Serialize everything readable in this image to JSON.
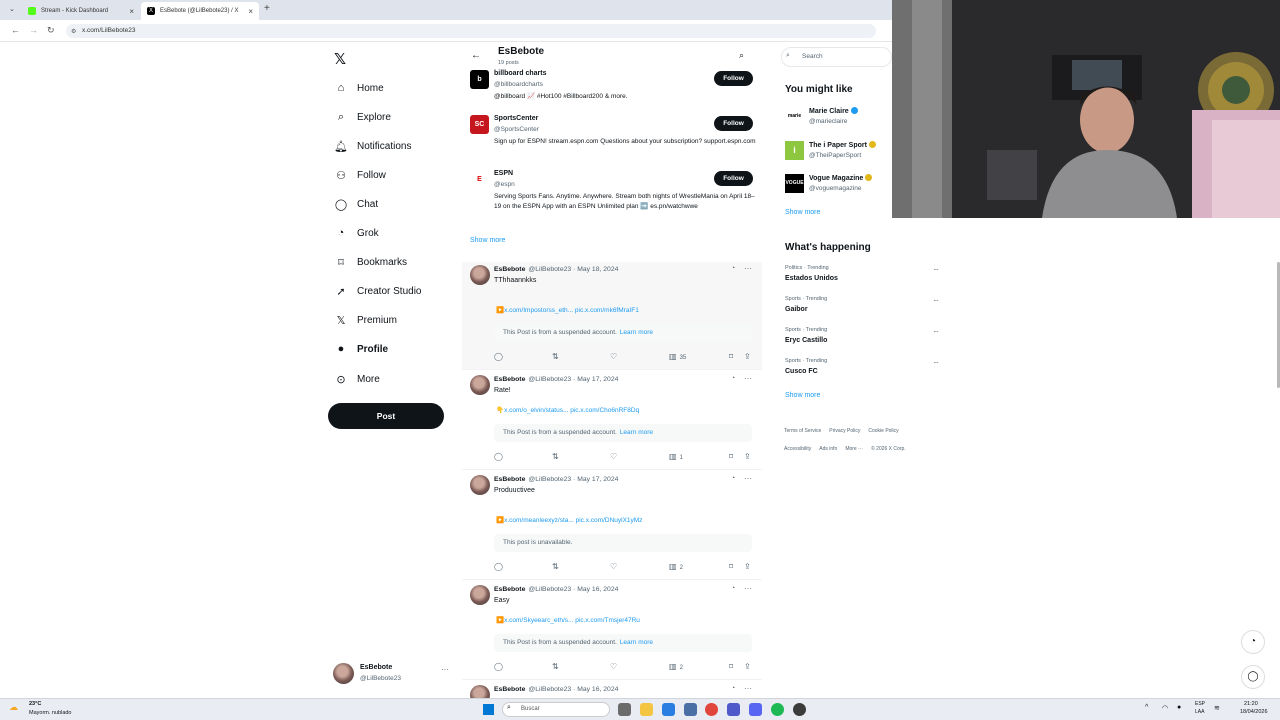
{
  "browser": {
    "tabs": [
      {
        "title": "Stream - Kick Dashboard",
        "color": "#53fc18"
      },
      {
        "title": "EsBebote (@LilBebote23) / X",
        "color": "#000000"
      }
    ],
    "url": "x.com/LilBebote23"
  },
  "sidebar": {
    "logo_icon": "x-logo-icon",
    "items": [
      {
        "label": "Home",
        "icon": "home-icon",
        "glyph": "⌂"
      },
      {
        "label": "Explore",
        "icon": "search-icon",
        "glyph": "⌕"
      },
      {
        "label": "Notifications",
        "icon": "bell-icon",
        "glyph": "🔔︎"
      },
      {
        "label": "Follow",
        "icon": "follow-icon",
        "glyph": "⚇"
      },
      {
        "label": "Chat",
        "icon": "chat-icon",
        "glyph": "◯"
      },
      {
        "label": "Grok",
        "icon": "grok-icon",
        "glyph": "◔"
      },
      {
        "label": "Bookmarks",
        "icon": "bookmark-icon",
        "glyph": "⌑"
      },
      {
        "label": "Creator Studio",
        "icon": "rocket-icon",
        "glyph": "➚"
      },
      {
        "label": "Premium",
        "icon": "x-premium-icon",
        "glyph": "𝕏"
      },
      {
        "label": "Profile",
        "icon": "profile-icon",
        "glyph": "●"
      },
      {
        "label": "More",
        "icon": "more-icon",
        "glyph": "⊙"
      }
    ],
    "post_label": "Post",
    "account": {
      "name": "EsBebote",
      "handle": "@LilBebote23"
    }
  },
  "header": {
    "name": "EsBebote",
    "posts_count": "19 posts"
  },
  "suggestions": [
    {
      "name": "billboard charts",
      "handle": "@billboardcharts",
      "bio": "@billboard 📈 #Hot100 #Billboard200 & more.",
      "follow": "Follow",
      "logo_bg": "#000000",
      "logo_text": "b"
    },
    {
      "name": "SportsCenter",
      "handle": "@SportsCenter",
      "bio": "Sign up for ESPN! stream.espn.com Questions about your subscription? support.espn.com",
      "follow": "Follow",
      "logo_bg": "#c4161c",
      "logo_text": "SC"
    },
    {
      "name": "ESPN",
      "handle": "@espn",
      "bio": "Serving Sports Fans. Anytime. Anywhere. Stream both nights of WrestleMania on April 18–19 on the ESPN App with an ESPN Unlimited plan ➡️ es.pn/watchwwe",
      "follow": "Follow",
      "logo_bg": "#ffffff",
      "logo_text": "E"
    }
  ],
  "show_more": "Show more",
  "tweets": [
    {
      "name": "EsBebote",
      "meta": "@LilBebote23 · May 18, 2024",
      "text": "TThhaannkks",
      "link": "▶️x.com/Impostorss_eth... pic.x.com/mk6fMraIF1",
      "notice": "This Post is from a suspended account.",
      "learn": "Learn more",
      "views": "35"
    },
    {
      "name": "EsBebote",
      "meta": "@LilBebote23 · May 17, 2024",
      "text": "Rate!",
      "link": "👇x.com/o_elvin/status... pic.x.com/Cho6nRF8Dq",
      "notice": "This Post is from a suspended account.",
      "learn": "Learn more",
      "views": "1"
    },
    {
      "name": "EsBebote",
      "meta": "@LilBebote23 · May 17, 2024",
      "text": "Produuctivee",
      "link": "▶️x.com/meanleexyz/sta... pic.x.com/DNuylX1yMz",
      "notice": "This post is unavailable.",
      "learn": "",
      "views": "2"
    },
    {
      "name": "EsBebote",
      "meta": "@LilBebote23 · May 16, 2024",
      "text": "Easy",
      "link": "▶️x.com/Skyeearc_eth/s... pic.x.com/Tmsjer47Ru",
      "notice": "This Post is from a suspended account.",
      "learn": "Learn more",
      "views": "2"
    },
    {
      "name": "EsBebote",
      "meta": "@LilBebote23 · May 16, 2024",
      "text": "",
      "link": "",
      "notice": "",
      "learn": "",
      "views": ""
    }
  ],
  "right": {
    "search_placeholder": "Search",
    "you_might_like": "You might like",
    "people": [
      {
        "name": "Marie Claire",
        "handle": "@marieclaire",
        "badge": "blue",
        "logo_bg": "#ffffff",
        "logo_text": "marie claire"
      },
      {
        "name": "The i Paper Sport",
        "handle": "@TheiPaperSport",
        "badge": "gold",
        "logo_bg": "#8dc63f",
        "logo_text": "i"
      },
      {
        "name": "Vogue Magazine",
        "handle": "@voguemagazine",
        "badge": "gold",
        "logo_bg": "#000000",
        "logo_text": "VOGUE"
      }
    ],
    "show_more": "Show more",
    "whats_happening": "What's happening",
    "trends": [
      {
        "category": "Politics · Trending",
        "name": "Estados Unidos"
      },
      {
        "category": "Sports · Trending",
        "name": "Gaibor"
      },
      {
        "category": "Sports · Trending",
        "name": "Eryc Castillo"
      },
      {
        "category": "Sports · Trending",
        "name": "Cusco FC"
      }
    ],
    "trends_show_more": "Show more",
    "footer": [
      "Terms of Service",
      "Privacy Policy",
      "Cookie Policy",
      "Accessibility",
      "Ads info",
      "More ···",
      "© 2026 X Corp."
    ]
  },
  "taskbar": {
    "weather_temp": "23°C",
    "weather_desc": "Mayorm. nublado",
    "search_placeholder": "Buscar",
    "lang_top": "ESP",
    "lang_bottom": "LAA",
    "time": "21:20",
    "date": "18/04/2026"
  }
}
